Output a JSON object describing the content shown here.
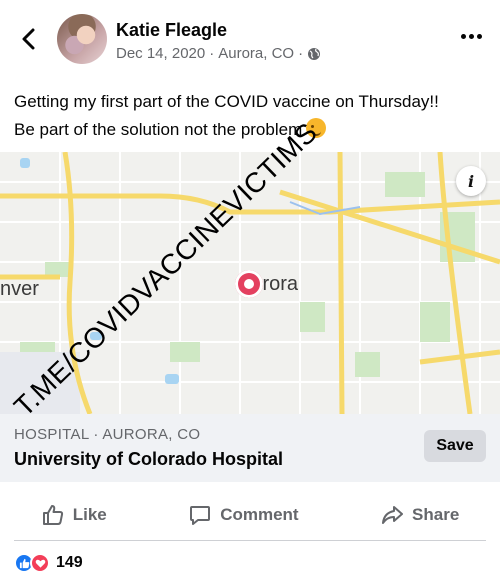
{
  "header": {
    "author": "Katie Fleagle",
    "date": "Dec 14, 2020",
    "separator": "·",
    "location": "Aurora, CO",
    "privacy_icon": "globe-icon"
  },
  "post": {
    "line1": "Getting my first part of the COVID vaccine on Thursday!!",
    "line2": "Be part of the solution not the problem",
    "emoji": "winking-face-emoji"
  },
  "map": {
    "label_left": "nver",
    "label_city": "Aurora",
    "watermark": "T.ME/COVIDVACCINEVICTIMS",
    "info_label": "i"
  },
  "place": {
    "category": "HOSPITAL · AURORA, CO",
    "name": "University of Colorado Hospital",
    "save_label": "Save"
  },
  "actions": {
    "like": "Like",
    "comment": "Comment",
    "share": "Share"
  },
  "reactions": {
    "count": "149",
    "types": [
      "like",
      "love"
    ]
  },
  "colors": {
    "pin": "#e4405f",
    "like_blue": "#1877f2",
    "love_red": "#f33e58",
    "road_yellow": "#f6d96b"
  }
}
